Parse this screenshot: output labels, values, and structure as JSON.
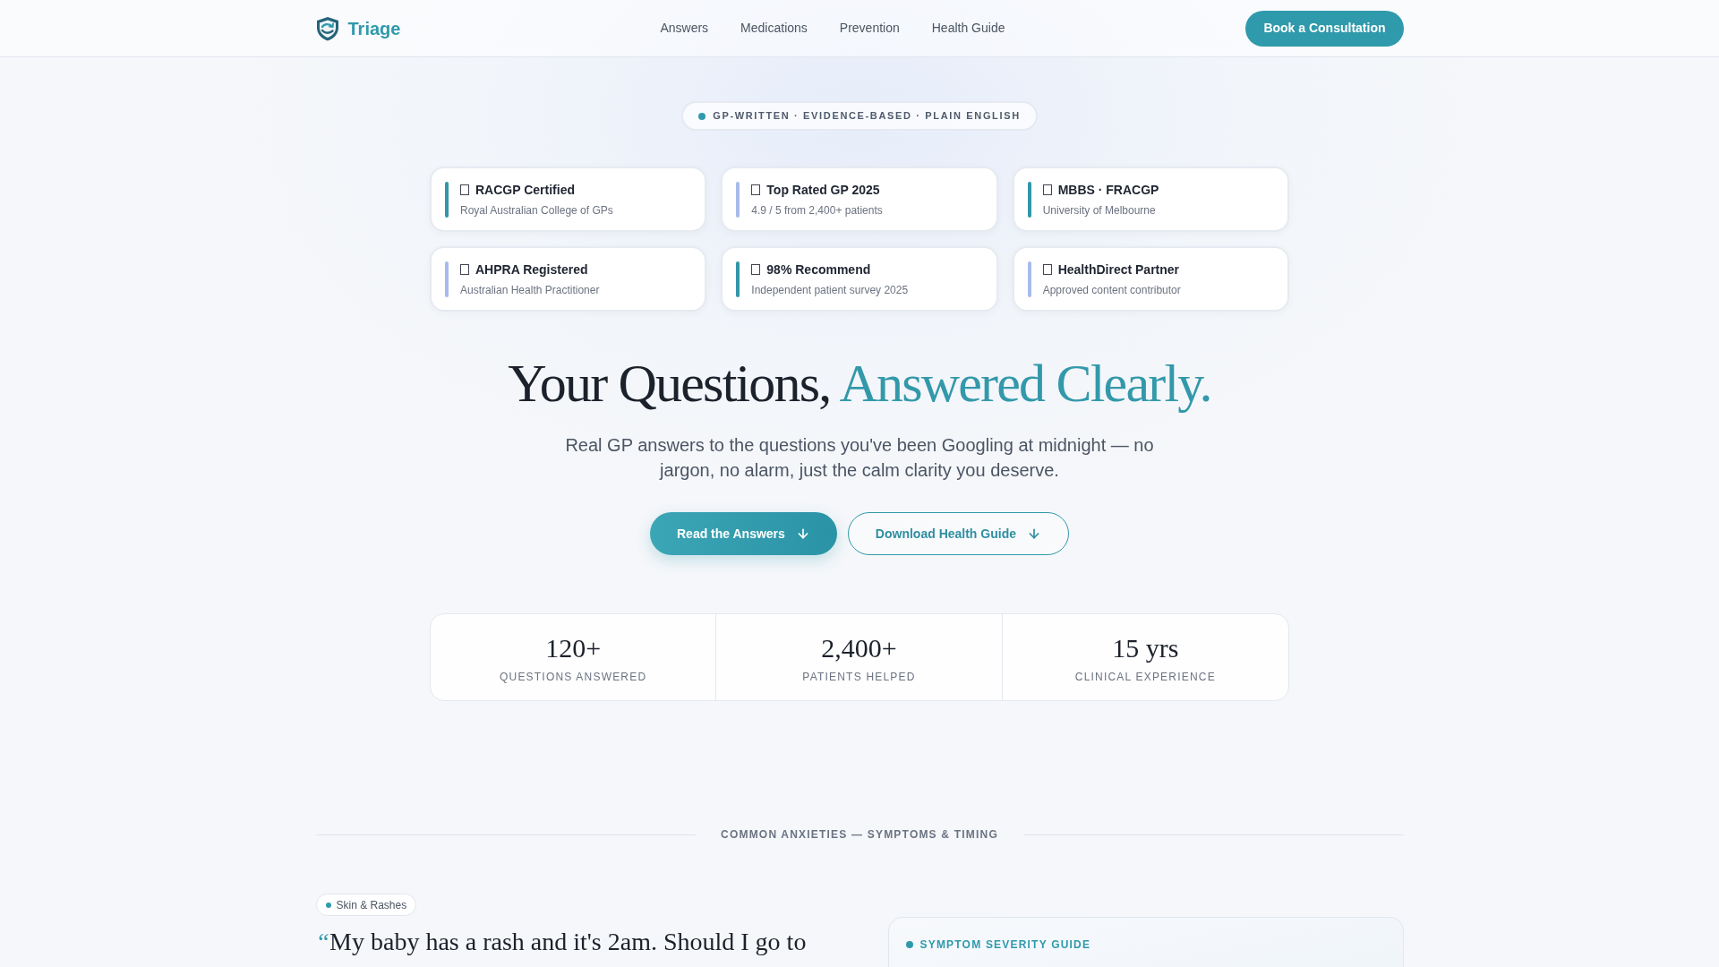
{
  "header": {
    "logo": "Triage",
    "nav": [
      {
        "label": "Answers"
      },
      {
        "label": "Medications"
      },
      {
        "label": "Prevention"
      },
      {
        "label": "Health Guide"
      }
    ],
    "cta": "Book a Consultation"
  },
  "hero": {
    "badge": "GP-WRITTEN · EVIDENCE-BASED · PLAIN ENGLISH",
    "credentials": [
      {
        "title": "RACGP Certified",
        "subtitle": "Royal Australian College of GPs",
        "color": "#3197a8"
      },
      {
        "title": "Top Rated GP 2025",
        "subtitle": "4.9 / 5 from 2,400+ patients",
        "color": "#a8bbea"
      },
      {
        "title": "MBBS · FRACGP",
        "subtitle": "University of Melbourne",
        "color": "#3197a8"
      },
      {
        "title": "AHPRA Registered",
        "subtitle": "Australian Health Practitioner",
        "color": "#a8bbea"
      },
      {
        "title": "98% Recommend",
        "subtitle": "Independent patient survey 2025",
        "color": "#3197a8"
      },
      {
        "title": "HealthDirect Partner",
        "subtitle": "Approved content contributor",
        "color": "#a8bbea"
      }
    ],
    "title": "Your Questions,",
    "title_accent": "Answered Clearly.",
    "subtitle": "Real GP answers to the questions you've been Googling at midnight — no jargon, no alarm, just the calm clarity you deserve.",
    "buttons": [
      {
        "label": "Read the Answers",
        "kind": "primary"
      },
      {
        "label": "Download Health Guide",
        "kind": "outline"
      }
    ],
    "stats": [
      {
        "value": "120+",
        "label": "QUESTIONS ANSWERED"
      },
      {
        "value": "2,400+",
        "label": "PATIENTS HELPED"
      },
      {
        "value": "15 yrs",
        "label": "CLINICAL EXPERIENCE"
      }
    ]
  },
  "section": {
    "heading": "COMMON ANXIETIES — SYMPTOMS & TIMING",
    "tag": "Skin & Rashes",
    "quote_mark": "“",
    "question": "My baby has a rash and it's 2am. Should I go to",
    "guide": {
      "title": "SYMPTOM SEVERITY GUIDE"
    }
  }
}
